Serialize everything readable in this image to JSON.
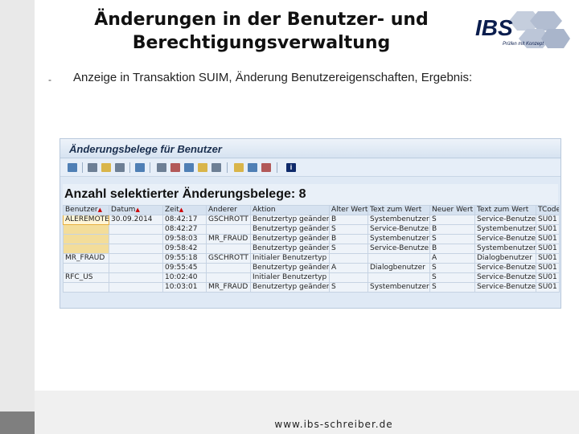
{
  "slide": {
    "title_line1": "Änderungen in der Benutzer- und",
    "title_line2": "Berechtigungsverwaltung",
    "bullet": "-",
    "intro": "Anzeige in Transaktion SUIM, Änderung Benutzereigenschaften, Ergebnis:",
    "footer": "www.ibs-schreiber.de"
  },
  "logo": {
    "text": "IBS",
    "tagline": "Prüfen mit Konzept",
    "colors": {
      "hex": "#b9c3d6",
      "text": "#0b1e4e"
    }
  },
  "sap": {
    "window_title": "Änderungsbelege für Benutzer",
    "toolbar_icons": [
      "refresh-icon",
      "print-icon",
      "sort-ascending-icon",
      "filter-icon",
      "find-icon",
      "export-icon",
      "layout-icon",
      "details-icon",
      "sum-icon",
      "select-layout-icon",
      "chart-icon",
      "mail-icon",
      "graphic-icon",
      "info-icon"
    ],
    "info_label": "i",
    "count_label": "Anzahl selektierter Änderungsbelege: 8",
    "columns": [
      "Benutzer",
      "Datum",
      "Zeit",
      "Änderer",
      "Aktion",
      "Alter Wert",
      "Text zum Wert",
      "Neuer Wert",
      "Text zum Wert",
      "TCode"
    ],
    "rows": [
      [
        "ALEREMOTE",
        "30.09.2014",
        "08:42:17",
        "GSCHROTT",
        "Benutzertyp geändert",
        "B",
        "Systembenutzer",
        "S",
        "Service-Benutzer",
        "SU01"
      ],
      [
        "",
        "",
        "08:42:27",
        "",
        "Benutzertyp geändert",
        "S",
        "Service-Benutzer",
        "B",
        "Systembenutzer",
        "SU01"
      ],
      [
        "",
        "",
        "09:58:03",
        "MR_FRAUD",
        "Benutzertyp geändert",
        "B",
        "Systembenutzer",
        "S",
        "Service-Benutzer",
        "SU01"
      ],
      [
        "",
        "",
        "09:58:42",
        "",
        "Benutzertyp geändert",
        "S",
        "Service-Benutzer",
        "B",
        "Systembenutzer",
        "SU01"
      ],
      [
        "MR_FRAUD",
        "",
        "09:55:18",
        "GSCHROTT",
        "Initialer Benutzertyp",
        "",
        "",
        "A",
        "Dialogbenutzer",
        "SU01"
      ],
      [
        "",
        "",
        "09:55:45",
        "",
        "Benutzertyp geändert",
        "A",
        "Dialogbenutzer",
        "S",
        "Service-Benutzer",
        "SU01"
      ],
      [
        "RFC_US",
        "",
        "10:02:40",
        "",
        "Initialer Benutzertyp",
        "",
        "",
        "S",
        "Service-Benutzer",
        "SU01"
      ],
      [
        "",
        "",
        "10:03:01",
        "MR_FRAUD",
        "Benutzertyp geändert",
        "S",
        "Systembenutzer",
        "S",
        "Service-Benutzer",
        "SU01"
      ]
    ]
  }
}
